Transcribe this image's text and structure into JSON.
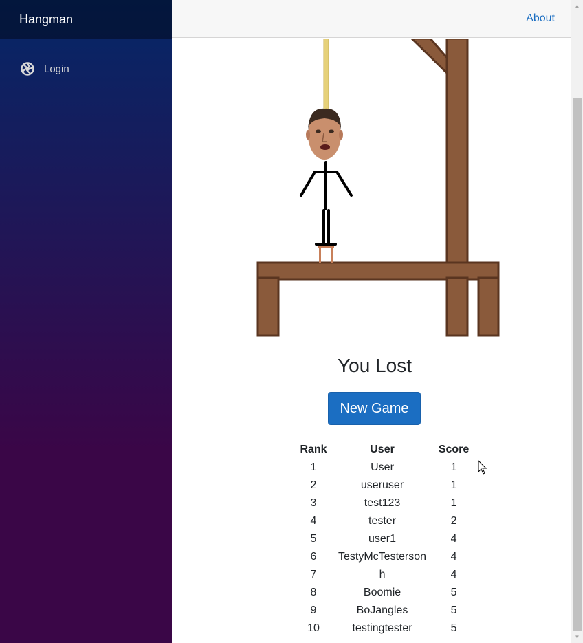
{
  "sidebar": {
    "brand": "Hangman",
    "items": [
      {
        "label": "Login",
        "icon": "aperture-icon"
      }
    ]
  },
  "topbar": {
    "about_label": "About"
  },
  "game": {
    "result": "You Lost",
    "new_game_label": "New Game"
  },
  "leaderboard": {
    "headers": {
      "rank": "Rank",
      "user": "User",
      "score": "Score"
    },
    "rows": [
      {
        "rank": "1",
        "user": "User",
        "score": "1"
      },
      {
        "rank": "2",
        "user": "useruser",
        "score": "1"
      },
      {
        "rank": "3",
        "user": "test123",
        "score": "1"
      },
      {
        "rank": "4",
        "user": "tester",
        "score": "2"
      },
      {
        "rank": "5",
        "user": "user1",
        "score": "4"
      },
      {
        "rank": "6",
        "user": "TestyMcTesterson",
        "score": "4"
      },
      {
        "rank": "7",
        "user": "h",
        "score": "4"
      },
      {
        "rank": "8",
        "user": "Boomie",
        "score": "5"
      },
      {
        "rank": "9",
        "user": "BoJangles",
        "score": "5"
      },
      {
        "rank": "10",
        "user": "testingtester",
        "score": "5"
      }
    ]
  },
  "colors": {
    "accent": "#1b6ec2",
    "sidebar_top": "#052767",
    "sidebar_bottom": "#3a0647",
    "wood": "#8a5a3b",
    "wood_dark": "#5a3520"
  }
}
